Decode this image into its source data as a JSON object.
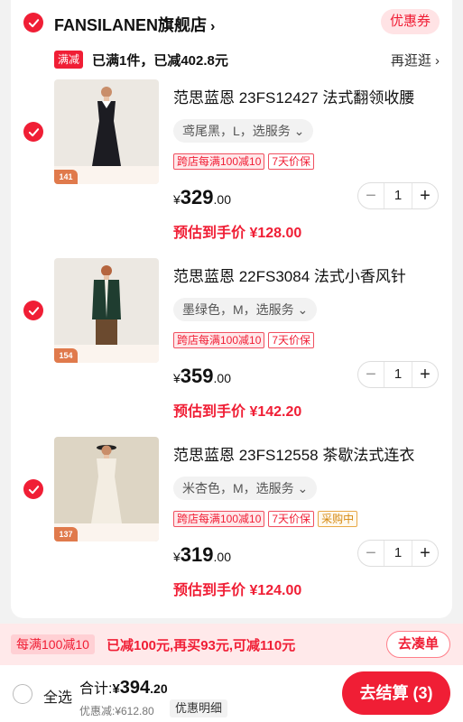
{
  "store": {
    "name": "FANSILANEN旗舰店",
    "chevron": "›",
    "coupon_label": "优惠券"
  },
  "promo": {
    "tag": "满减",
    "text": "已满1件，已减402.8元",
    "more": "再逛逛 ›"
  },
  "items": [
    {
      "title": "范思蓝恩 23FS12427 法式翻领收腰",
      "spec": "鸢尾黑，L，选服务 ⌄",
      "tags": [
        "跨店每满100减10",
        "7天价保"
      ],
      "price_symbol": "¥",
      "price_int": "329",
      "price_dec": ".00",
      "qty": "1",
      "estimate": "预估到手价 ¥128.00",
      "badge": "141",
      "dress_color": "#1c1c22"
    },
    {
      "title": "范思蓝恩 22FS3084 法式小香风针",
      "spec": "墨绿色，M，选服务 ⌄",
      "tags": [
        "跨店每满100减10",
        "7天价保"
      ],
      "price_symbol": "¥",
      "price_int": "359",
      "price_dec": ".00",
      "qty": "1",
      "estimate": "预估到手价 ¥142.20",
      "badge": "154",
      "dress_color": "#1f3d30"
    },
    {
      "title": "范思蓝恩 23FS12558 茶歇法式连衣",
      "spec": "米杏色，M，选服务 ⌄",
      "tags": [
        "跨店每满100减10",
        "7天价保",
        "采购中"
      ],
      "price_symbol": "¥",
      "price_int": "319",
      "price_dec": ".00",
      "qty": "1",
      "estimate": "预估到手价 ¥124.00",
      "badge": "137",
      "dress_color": "#f3ede2"
    }
  ],
  "stepper": {
    "minus": "−",
    "plus": "+"
  },
  "promo_bar": {
    "badge": "每满100减10",
    "text": "已减100元,再买93元,可减110元",
    "button": "去凑单"
  },
  "footer": {
    "select_all": "全选",
    "total_label": "合计:",
    "total_symbol": "¥",
    "total_int": "394",
    "total_dec": ".20",
    "saved": "优惠减:¥612.80",
    "detail": "优惠明细",
    "checkout": "去结算 (3)"
  },
  "colors": {
    "accent": "#f01e35",
    "promo_bg": "#ffe9ea"
  }
}
